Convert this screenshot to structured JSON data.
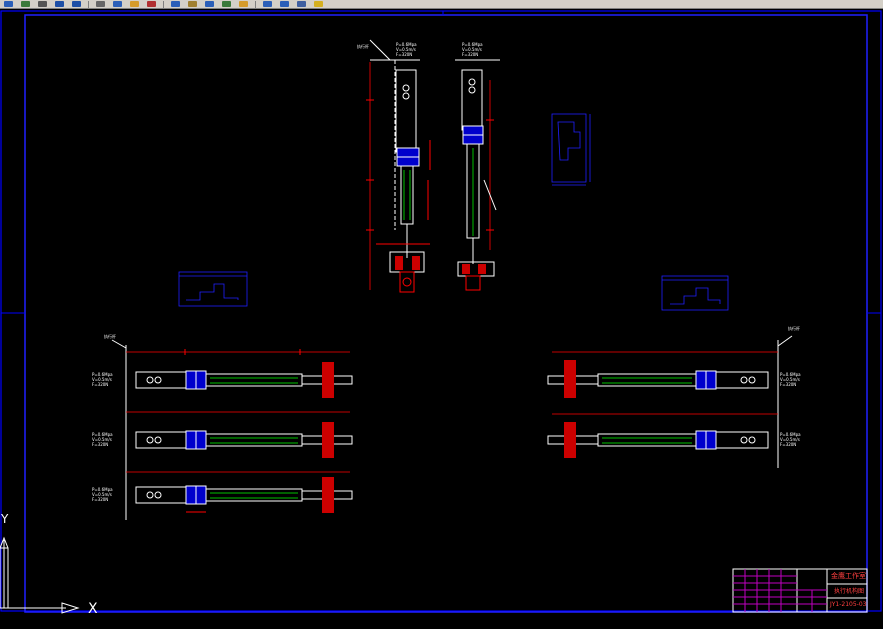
{
  "toolbar": {
    "buttons": [
      {
        "icon": "save-icon",
        "color": "#2b5fb8"
      },
      {
        "icon": "print-icon",
        "color": "#3a7a3a"
      },
      {
        "icon": "zoom-icon",
        "color": "#555555"
      },
      {
        "icon": "undo-icon",
        "color": "#1d4fa6"
      },
      {
        "icon": "redo-icon",
        "color": "#1d4fa6"
      },
      {
        "icon": "cut-icon",
        "color": "#666666"
      },
      {
        "icon": "copy-icon",
        "color": "#2b5fb8"
      },
      {
        "icon": "paste-icon",
        "color": "#d49b2b"
      },
      {
        "icon": "match-icon",
        "color": "#b03030"
      },
      {
        "icon": "pan-icon",
        "color": "#2b5fb8"
      },
      {
        "icon": "zoom-window-icon",
        "color": "#a08030"
      },
      {
        "icon": "properties-icon",
        "color": "#2b5fb8"
      },
      {
        "icon": "design-center-icon",
        "color": "#3a7a3a"
      },
      {
        "icon": "tool-palette-icon",
        "color": "#d49b2b"
      },
      {
        "icon": "layer-icon",
        "color": "#2b5fb8"
      },
      {
        "icon": "help-icon",
        "color": "#2b5fb8"
      },
      {
        "icon": "3d-orbit-icon",
        "color": "#4060a0"
      },
      {
        "icon": "color-icon",
        "color": "#d4b020"
      }
    ]
  },
  "drawing": {
    "background": "#000000",
    "frame_color": "#0000ff",
    "line_color": "#ffffff",
    "dim_color": "#ff0000",
    "part_color": "#00c000",
    "detail_color": "#0000ff"
  },
  "title_block": {
    "company": "金鹰工作室",
    "drawing_name": "执行机构图",
    "drawing_no": "JY1-2105-03"
  },
  "ucs": {
    "x_label": "X",
    "y_label": "Y"
  }
}
